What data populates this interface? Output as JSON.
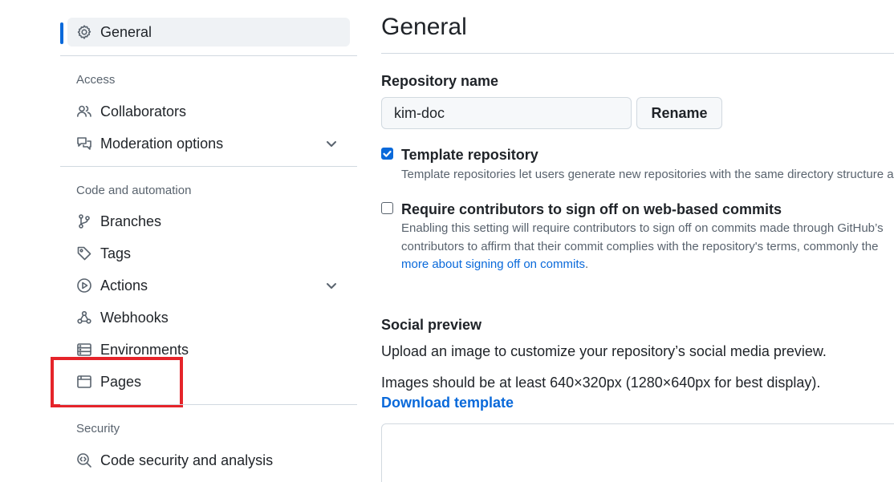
{
  "sidebar": {
    "general": "General",
    "access_heading": "Access",
    "collaborators": "Collaborators",
    "moderation": "Moderation options",
    "code_heading": "Code and automation",
    "branches": "Branches",
    "tags": "Tags",
    "actions": "Actions",
    "webhooks": "Webhooks",
    "environments": "Environments",
    "pages": "Pages",
    "security_heading": "Security",
    "code_security": "Code security and analysis"
  },
  "main": {
    "title": "General",
    "repo_name_label": "Repository name",
    "repo_name_value": "kim-doc",
    "rename_label": "Rename",
    "template_repo": {
      "label": "Template repository",
      "checked": true,
      "description": "Template repositories let users generate new repositories with the same directory structure an"
    },
    "sign_off": {
      "label": "Require contributors to sign off on web-based commits",
      "checked": false,
      "description_line1": "Enabling this setting will require contributors to sign off on commits made through GitHub’s",
      "description_line2": "contributors to affirm that their commit complies with the repository's terms, commonly the",
      "link_text": "more about signing off on commits",
      "link_end": "."
    },
    "social_preview": {
      "heading": "Social preview",
      "text1": "Upload an image to customize your repository’s social media preview.",
      "text2": "Images should be at least 640×320px (1280×640px for best display).",
      "download_label": "Download template"
    }
  },
  "colors": {
    "accent": "#0969da",
    "highlight": "#e5242a",
    "muted": "#59636e",
    "border": "#d1d9e0"
  }
}
